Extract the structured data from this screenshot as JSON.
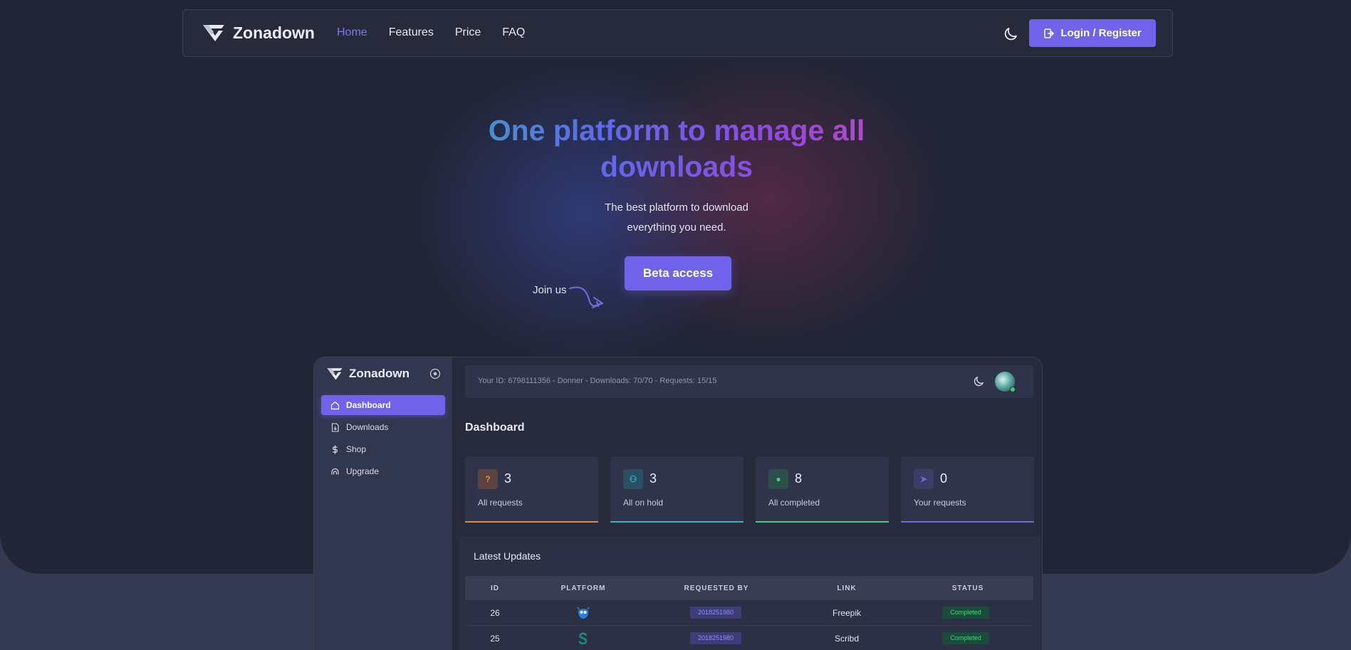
{
  "brand": {
    "name": "Zonadown"
  },
  "nav": {
    "links": [
      {
        "label": "Home",
        "active": true
      },
      {
        "label": "Features",
        "active": false
      },
      {
        "label": "Price",
        "active": false
      },
      {
        "label": "FAQ",
        "active": false
      }
    ],
    "login_label": "Login / Register"
  },
  "hero": {
    "title": "One platform to manage all downloads",
    "subtitle_line1": "The best platform to download",
    "subtitle_line2": "everything you need.",
    "cta_label": "Beta access",
    "join_label": "Join us"
  },
  "dashboard": {
    "brand": "Zonadown",
    "sidebar": [
      {
        "label": "Dashboard",
        "icon": "home-icon",
        "active": true
      },
      {
        "label": "Downloads",
        "icon": "file-download-icon",
        "active": false
      },
      {
        "label": "Shop",
        "icon": "dollar-icon",
        "active": false
      },
      {
        "label": "Upgrade",
        "icon": "upgrade-icon",
        "active": false
      }
    ],
    "user_info": "Your ID: 6798111356 - Donner - Downloads: 70/70 - Requests: 15/15",
    "heading": "Dashboard",
    "stats": [
      {
        "value": "3",
        "label": "All requests",
        "icon_text": "?",
        "color": "#e08a4a",
        "icon_bg": "#5a4340"
      },
      {
        "value": "3",
        "label": "All on hold",
        "icon_text": "⚇",
        "color": "#2fb7c4",
        "icon_bg": "#2b4f63"
      },
      {
        "value": "8",
        "label": "All completed",
        "icon_text": "●",
        "color": "#3ccf8a",
        "icon_bg": "#2d4e4a"
      },
      {
        "value": "0",
        "label": "Your requests",
        "icon_text": "➤",
        "color": "#6e6bd8",
        "icon_bg": "#3b3d66"
      }
    ],
    "updates": {
      "title": "Latest Updates",
      "columns": [
        "ID",
        "PLATFORM",
        "REQUESTED BY",
        "LINK",
        "STATUS"
      ],
      "rows": [
        {
          "id": "26",
          "platform_icon": "freepik-icon",
          "requested_by": "2018251980",
          "link": "Freepik",
          "status": "Completed"
        },
        {
          "id": "25",
          "platform_icon": "scribd-icon",
          "requested_by": "2018251980",
          "link": "Scribd",
          "status": "Completed"
        }
      ]
    }
  },
  "colors": {
    "accent": "#7063e9",
    "background": "#222536"
  }
}
